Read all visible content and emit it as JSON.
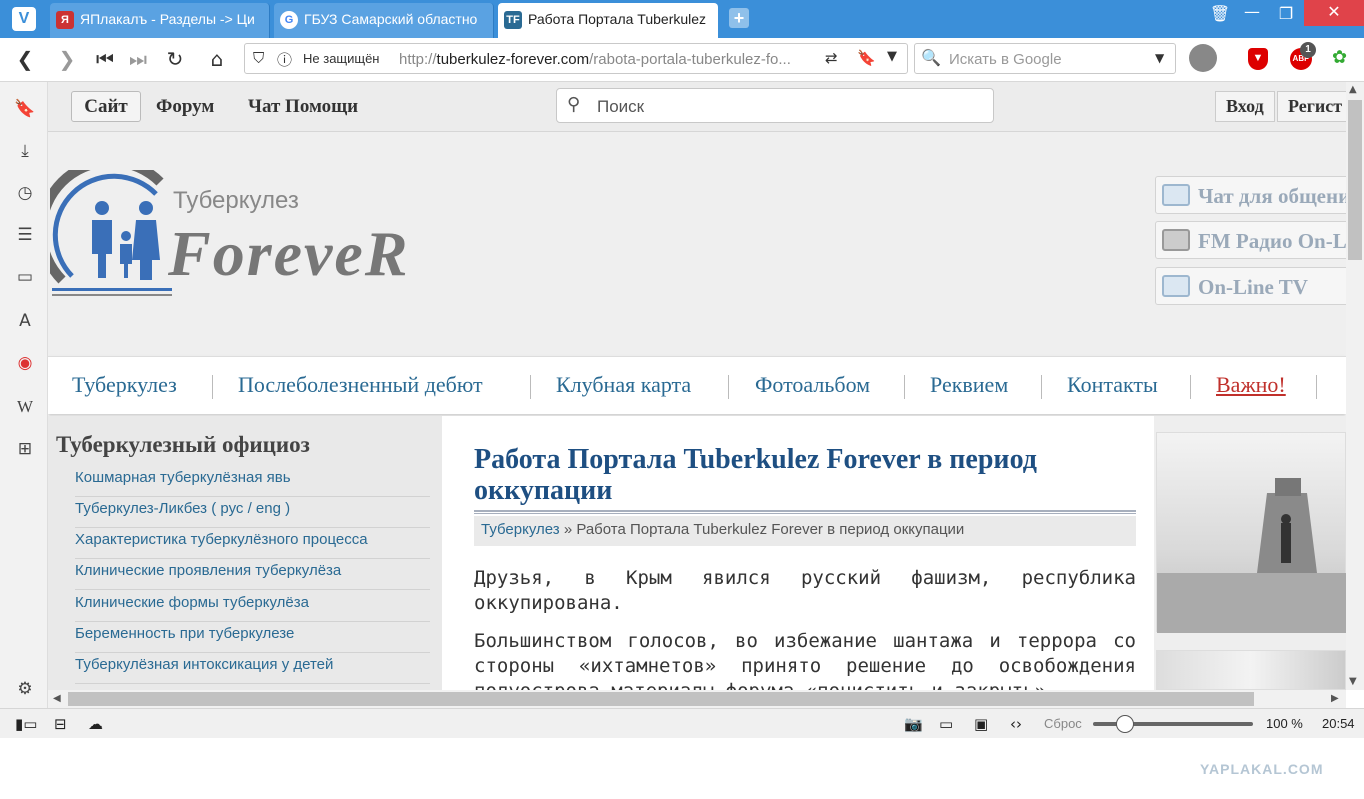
{
  "browser": {
    "tabs": [
      {
        "label": "ЯПлакалъ - Разделы -> Ци"
      },
      {
        "label": "ГБУЗ Самарский областно"
      },
      {
        "label": "Работа Портала Tuberkulez"
      }
    ],
    "address": {
      "security": "Не защищён",
      "url_prefix": "http://",
      "url_domain": "tuberkulez-forever.com",
      "url_path": "/rabota-portala-tuberkulez-fo..."
    },
    "search_placeholder": "Искать в Google",
    "extension_badge": "1",
    "adblock_label": "ABP"
  },
  "site": {
    "topnav": {
      "site": "Сайт",
      "forum": "Форум",
      "chat": "Чат Помощи",
      "search_placeholder": "Поиск",
      "login": "Вход",
      "register": "Регист"
    },
    "brand": {
      "sub": "Туберкулез",
      "main": "ForeveR"
    },
    "side_buttons": [
      "Чат для общения",
      "FM Радио On-Line",
      "On-Line TV"
    ],
    "menu": [
      "Туберкулез",
      "Послеболезненный дебют",
      "Клубная карта",
      "Фотоальбом",
      "Реквием",
      "Контакты",
      "Важно!"
    ],
    "sidebar": {
      "title": "Туберкулезный официоз",
      "links": [
        "Кошмарная туберкулёзная явь",
        "Туберкулез-Ликбез ( рус / eng )",
        "Характеристика туберкулёзного процесса",
        "Клинические проявления туберкулёза",
        "Клинические формы туберкулёза",
        "Беременность при туберкулезе",
        "Туберкулёзная интоксикация у детей"
      ]
    },
    "article": {
      "title": "Работа Портала Tuberkulez Forever в период оккупации",
      "crumb_home": "Туберкулез",
      "crumb_sep": "»",
      "crumb_current": "Работа Портала Tuberkulez Forever в период оккупации",
      "para1": "Друзья, в Крым явился русский фашизм, республика оккупирована.",
      "para2": "Большинством голосов, во избежание шантажа и террора со стороны «ихтамнетов» принято решение до освобождения полуострова материалы форума «почистить и закрыть»."
    }
  },
  "status": {
    "reset": "Сброс",
    "zoom": "100 %",
    "time": "20:54",
    "zoom_level": 0.15
  },
  "watermark": "YAPLAKAL.COM"
}
